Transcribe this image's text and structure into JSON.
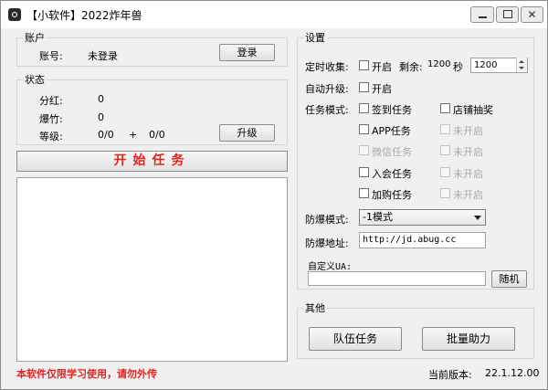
{
  "window": {
    "title": "【小软件】2022炸年兽",
    "close_glyph": "✕"
  },
  "account": {
    "group_label": "账户",
    "account_label": "账号:",
    "account_value": "未登录",
    "login_button": "登录"
  },
  "status": {
    "group_label": "状态",
    "dividend_label": "分红:",
    "dividend_value": "0",
    "firecracker_label": "爆竹:",
    "firecracker_value": "0",
    "level_label": "等级:",
    "level_value_a": "0/0",
    "level_plus": "+",
    "level_value_b": "0/0",
    "upgrade_button": "升级"
  },
  "start_button": "开始任务",
  "footer": {
    "note": "本软件仅限学习使用，请勿外传",
    "version_label": "当前版本:",
    "version_value": "22.1.12.00"
  },
  "settings": {
    "group_label": "设置",
    "timer_label": "定时收集:",
    "timer_enable": "开启",
    "timer_remaining_label": "剩余:",
    "timer_remaining_value": "1200",
    "timer_unit": "秒",
    "timer_spin_value": "1200",
    "auto_upgrade_label": "自动升级:",
    "auto_upgrade_enable": "开启",
    "task_mode_label": "任务模式:",
    "tasks": [
      {
        "label": "签到任务",
        "enabled": true
      },
      {
        "label": "店铺抽奖",
        "enabled": true
      },
      {
        "label": "APP任务",
        "enabled": true
      },
      {
        "label": "未开启",
        "enabled": false
      },
      {
        "label": "微信任务",
        "enabled": false
      },
      {
        "label": "未开启",
        "enabled": false
      },
      {
        "label": "入会任务",
        "enabled": true
      },
      {
        "label": "未开启",
        "enabled": false
      },
      {
        "label": "加购任务",
        "enabled": true
      },
      {
        "label": "未开启",
        "enabled": false
      }
    ],
    "explode_mode_label": "防爆模式:",
    "explode_mode_value": "-1模式",
    "explode_addr_label": "防爆地址:",
    "explode_addr_value": "http://jd.abug.cc",
    "ua_label": "自定义UA:",
    "ua_value": "",
    "random_button": "随机"
  },
  "other": {
    "group_label": "其他",
    "team_task_button": "队伍任务",
    "batch_help_button": "批量助力"
  }
}
